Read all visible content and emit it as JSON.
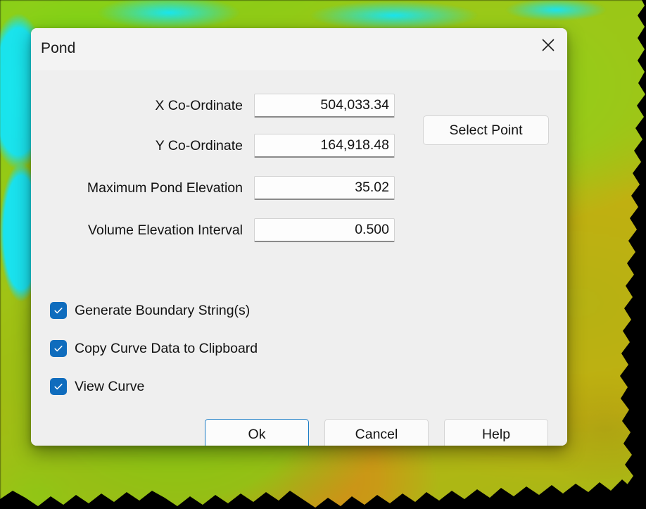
{
  "window": {
    "title": "Pond",
    "close_icon": "close-icon"
  },
  "form": {
    "fields": [
      {
        "label": "X Co-Ordinate",
        "value": "504,033.34",
        "name": "x-coordinate"
      },
      {
        "label": "Y Co-Ordinate",
        "value": "164,918.48",
        "name": "y-coordinate"
      },
      {
        "label": "Maximum Pond Elevation",
        "value": "35.02",
        "name": "maximum-pond-elevation"
      },
      {
        "label": "Volume Elevation Interval",
        "value": "0.500",
        "name": "volume-elevation-interval"
      }
    ],
    "select_point_label": "Select Point"
  },
  "checkboxes": [
    {
      "label": "Generate Boundary String(s)",
      "checked": true
    },
    {
      "label": "Copy Curve Data to Clipboard",
      "checked": true
    },
    {
      "label": "View Curve",
      "checked": true
    }
  ],
  "buttons": {
    "ok": "Ok",
    "cancel": "Cancel",
    "help": "Help"
  },
  "colors": {
    "accent": "#0f6cbd",
    "default_button_border": "#1a7bc4",
    "dialog_background": "#efefef",
    "title_bar_background": "#f3f3f3",
    "input_background": "#fdfdfd",
    "backdrop_black": "#000000",
    "terrain_green": "#8ccf18",
    "terrain_yellow": "#b5b514",
    "terrain_orange": "#d08a1a",
    "water_cyan": "#1ae3ec"
  },
  "backdrop": {
    "description": "blurred terrain elevation map with cyan water bodies over black background"
  }
}
